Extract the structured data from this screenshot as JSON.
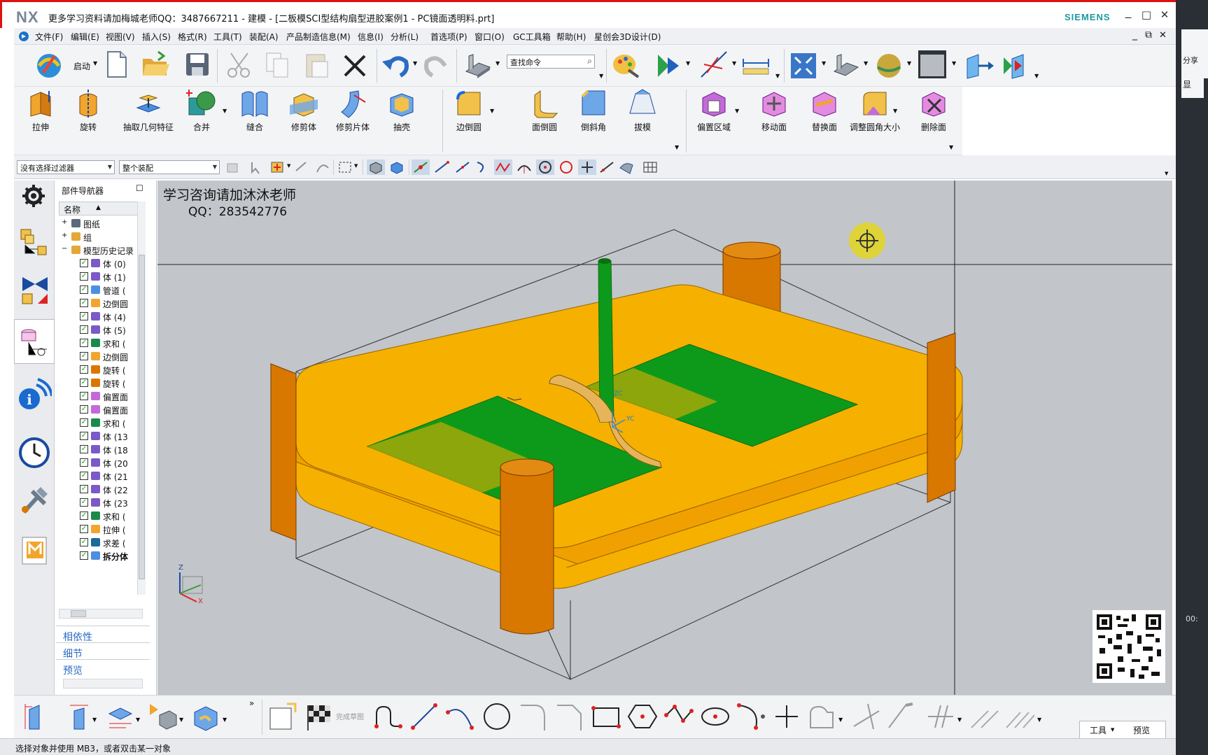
{
  "titlebar": {
    "logo": "NX",
    "title": "更多学习资料请加梅城老师QQ：3487667211 - 建模 - [二板模SCI型结构扇型进胶案例1 - PC镜面透明料.prt]",
    "brand": "SIEMENS",
    "minimize": "_",
    "maximize": "□",
    "close": "✕"
  },
  "menubar": {
    "items": [
      "文件(F)",
      "编辑(E)",
      "视图(V)",
      "插入(S)",
      "格式(R)",
      "工具(T)",
      "装配(A)",
      "产品制造信息(M)",
      "信息(I)",
      "分析(L)",
      "首选项(P)",
      "窗口(O)",
      "GC工具箱",
      "帮助(H)",
      "星创会3D设计(D)"
    ],
    "doc_min": "_",
    "doc_restore": "⧉",
    "doc_close": "✕"
  },
  "ribbon1": {
    "start_label": "启动",
    "search_placeholder": "查找命令"
  },
  "ribbon2": {
    "buttons": [
      "拉伸",
      "旋转",
      "抽取几何特征",
      "合并",
      "缝合",
      "修剪体",
      "修剪片体",
      "抽壳",
      "边倒圆",
      "面倒圆",
      "倒斜角",
      "拔模",
      "偏置区域",
      "移动面",
      "替换面",
      "调整圆角大小",
      "删除面"
    ]
  },
  "ribbon3": {
    "filter": "没有选择过滤器",
    "scope": "整个装配"
  },
  "navigator": {
    "title": "部件导航器",
    "column": "名称",
    "rows": [
      {
        "label": "图纸",
        "indent": 0,
        "kind": "drawing"
      },
      {
        "label": "组",
        "indent": 0,
        "kind": "folder"
      },
      {
        "label": "模型历史记录",
        "indent": 0,
        "kind": "folder"
      },
      {
        "label": "体 (0)",
        "indent": 1,
        "kind": "body"
      },
      {
        "label": "体 (1)",
        "indent": 1,
        "kind": "body"
      },
      {
        "label": "管道 (",
        "indent": 1,
        "kind": "tube"
      },
      {
        "label": "边倒圆",
        "indent": 1,
        "kind": "blend"
      },
      {
        "label": "体 (4)",
        "indent": 1,
        "kind": "body"
      },
      {
        "label": "体 (5)",
        "indent": 1,
        "kind": "body"
      },
      {
        "label": "求和 (",
        "indent": 1,
        "kind": "unite"
      },
      {
        "label": "边倒圆",
        "indent": 1,
        "kind": "blend"
      },
      {
        "label": "旋转 (",
        "indent": 1,
        "kind": "revolve"
      },
      {
        "label": "旋转 (",
        "indent": 1,
        "kind": "revolve"
      },
      {
        "label": "偏置面",
        "indent": 1,
        "kind": "offset"
      },
      {
        "label": "偏置面",
        "indent": 1,
        "kind": "offset"
      },
      {
        "label": "求和 (",
        "indent": 1,
        "kind": "unite"
      },
      {
        "label": "体 (13",
        "indent": 1,
        "kind": "body"
      },
      {
        "label": "体 (18",
        "indent": 1,
        "kind": "body"
      },
      {
        "label": "体 (20",
        "indent": 1,
        "kind": "body"
      },
      {
        "label": "体 (21",
        "indent": 1,
        "kind": "body"
      },
      {
        "label": "体 (22",
        "indent": 1,
        "kind": "body"
      },
      {
        "label": "体 (23",
        "indent": 1,
        "kind": "body"
      },
      {
        "label": "求和 (",
        "indent": 1,
        "kind": "unite"
      },
      {
        "label": "拉伸 (",
        "indent": 1,
        "kind": "extrude"
      },
      {
        "label": "求差 (",
        "indent": 1,
        "kind": "subtract"
      },
      {
        "label": "拆分体",
        "indent": 1,
        "kind": "split"
      }
    ],
    "sections": [
      "相依性",
      "细节",
      "预览"
    ]
  },
  "viewport": {
    "overlay_line1": "学习咨询请加沐沐老师",
    "overlay_line2": "QQ：283542776",
    "axis_z": "Z",
    "axis_x": "X",
    "wcs_zc": "ZC",
    "wcs_yc": "YC"
  },
  "bottombar": {
    "finish_sketch": "完成草图",
    "tools": "工具",
    "preview": "预览"
  },
  "status": {
    "text": "选择对象并使用 MB3，或者双击某一对象"
  },
  "right_strip": {
    "t1": "显",
    "t2": "分享",
    "time": "00:"
  },
  "colors": {
    "accent_orange": "#f6b000",
    "dark_orange": "#d87800",
    "green": "#0d9a1a",
    "dark_green": "#0a6e12",
    "viewport_bg": "#c2c5c9",
    "brand": "#1a9aa0"
  }
}
